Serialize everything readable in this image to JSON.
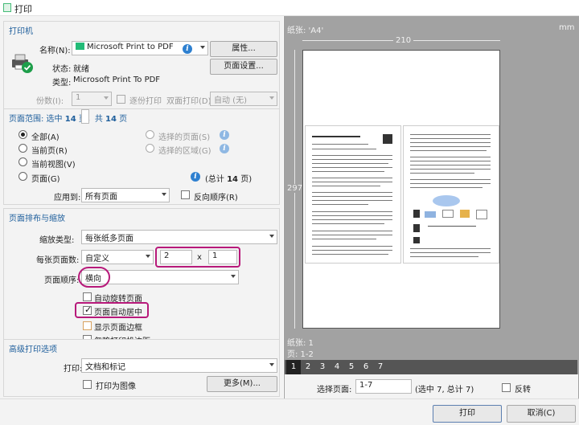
{
  "window": {
    "title": "打印"
  },
  "printer": {
    "header": "打印机",
    "name_label": "名称(N):",
    "name_value": "Microsoft Print to PDF",
    "properties_button": "属性...",
    "status_label": "状态:",
    "status_value": "就绪",
    "type_label": "类型:",
    "type_value": "Microsoft Print To PDF",
    "page_setup_button": "页面设置...",
    "copies_label": "份数(I):",
    "copies_value": "1",
    "collate_label": "逐份打印",
    "duplex_label": "双面打印(D):",
    "duplex_value": "自动 (无)"
  },
  "page_range": {
    "header_prefix": "页面范围: 选中 ",
    "header_count": "14",
    "header_middle": " 页，共 ",
    "header_total": "14",
    "header_suffix": " 页",
    "all": "全部(A)",
    "current_page": "当前页(R)",
    "current_view": "当前视图(V)",
    "pages": "页面(G)",
    "selected_pages": "选择的页面(S)",
    "selected_area": "选择的区域(G)",
    "total_prefix": "(总计 ",
    "total_count": "14",
    "total_suffix": " 页)",
    "apply_to_label": "应用到:",
    "apply_to_value": "所有页面",
    "reverse_label": "反向顺序(R)"
  },
  "layout": {
    "header": "页面排布与缩放",
    "scale_type_label": "缩放类型:",
    "scale_type_value": "每张纸多页面",
    "pages_per_sheet_label": "每张页面数:",
    "pages_per_sheet_value": "自定义",
    "cols": "2",
    "times": "x",
    "rows": "1",
    "page_order_label": "页面顺序:",
    "page_order_value": "横向",
    "auto_rotate": "自动旋转页面",
    "auto_center": "页面自动居中",
    "show_border": "显示页面边框",
    "ignore_margins": "忽略打印机边距"
  },
  "advanced": {
    "header": "高级打印选项",
    "print_label": "打印:",
    "print_value": "文档和标记",
    "print_as_image": "打印为图像",
    "more_button": "更多(M)..."
  },
  "preview": {
    "paper_label": "纸张: 'A4'",
    "unit": "mm",
    "width": "210",
    "height": "297",
    "sheet_info": "纸张: 1",
    "page_info": "页: 1-2",
    "tabs": [
      "1",
      "2",
      "3",
      "4",
      "5",
      "6",
      "7"
    ],
    "select_pages_label": "选择页面:",
    "select_pages_value": "1-7",
    "select_pages_info": "(选中 7, 总计 7)",
    "reverse_label": "反转"
  },
  "footer": {
    "print_button": "打印",
    "cancel_button": "取消(C)"
  }
}
